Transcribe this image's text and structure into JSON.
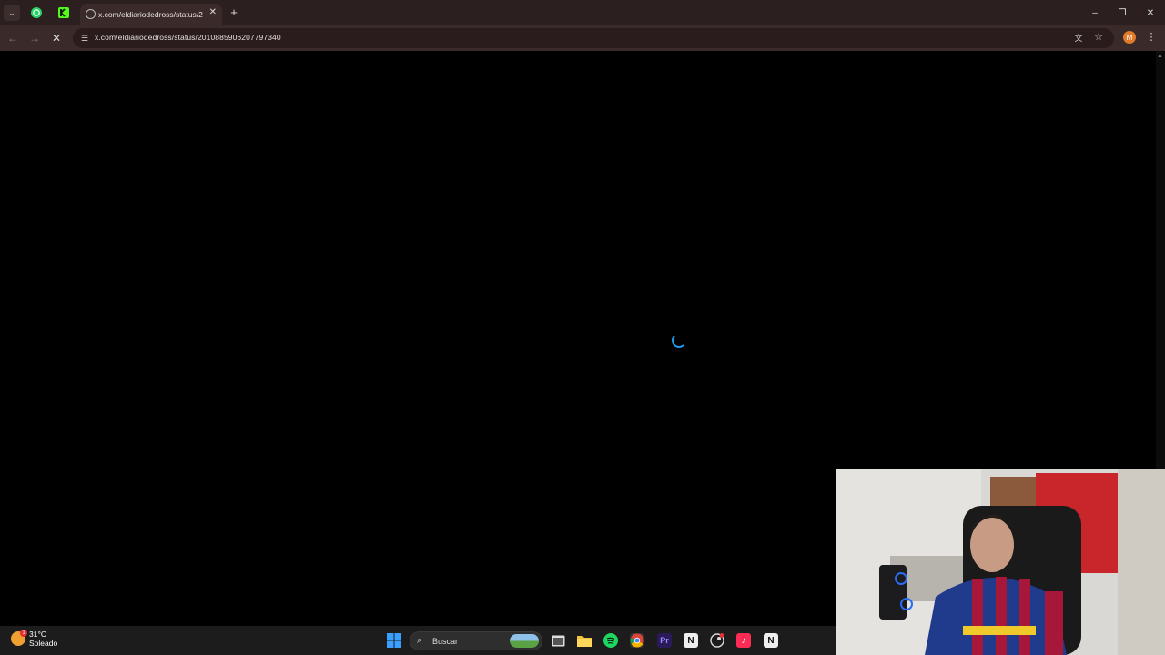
{
  "browser": {
    "tab": {
      "title": "x.com/eldiariodedross/status/2"
    },
    "address_bar": {
      "url": "x.com/eldiariodedross/status/2010885906207797340"
    },
    "profile_initial": "M"
  },
  "taskbar": {
    "weather": {
      "temp": "31°C",
      "condition": "Soleado",
      "badge": "1"
    },
    "search_label": "Buscar",
    "pinned_apps": [
      "windows-start",
      "task-view",
      "file-explorer",
      "spotify",
      "chrome",
      "premiere-pro",
      "notion",
      "steam",
      "tiktok",
      "notion-calendar"
    ]
  },
  "colors": {
    "tabstrip": "#2c1f1f",
    "toolbar": "#3b2a2a",
    "spinner": "#1d9bf0"
  }
}
